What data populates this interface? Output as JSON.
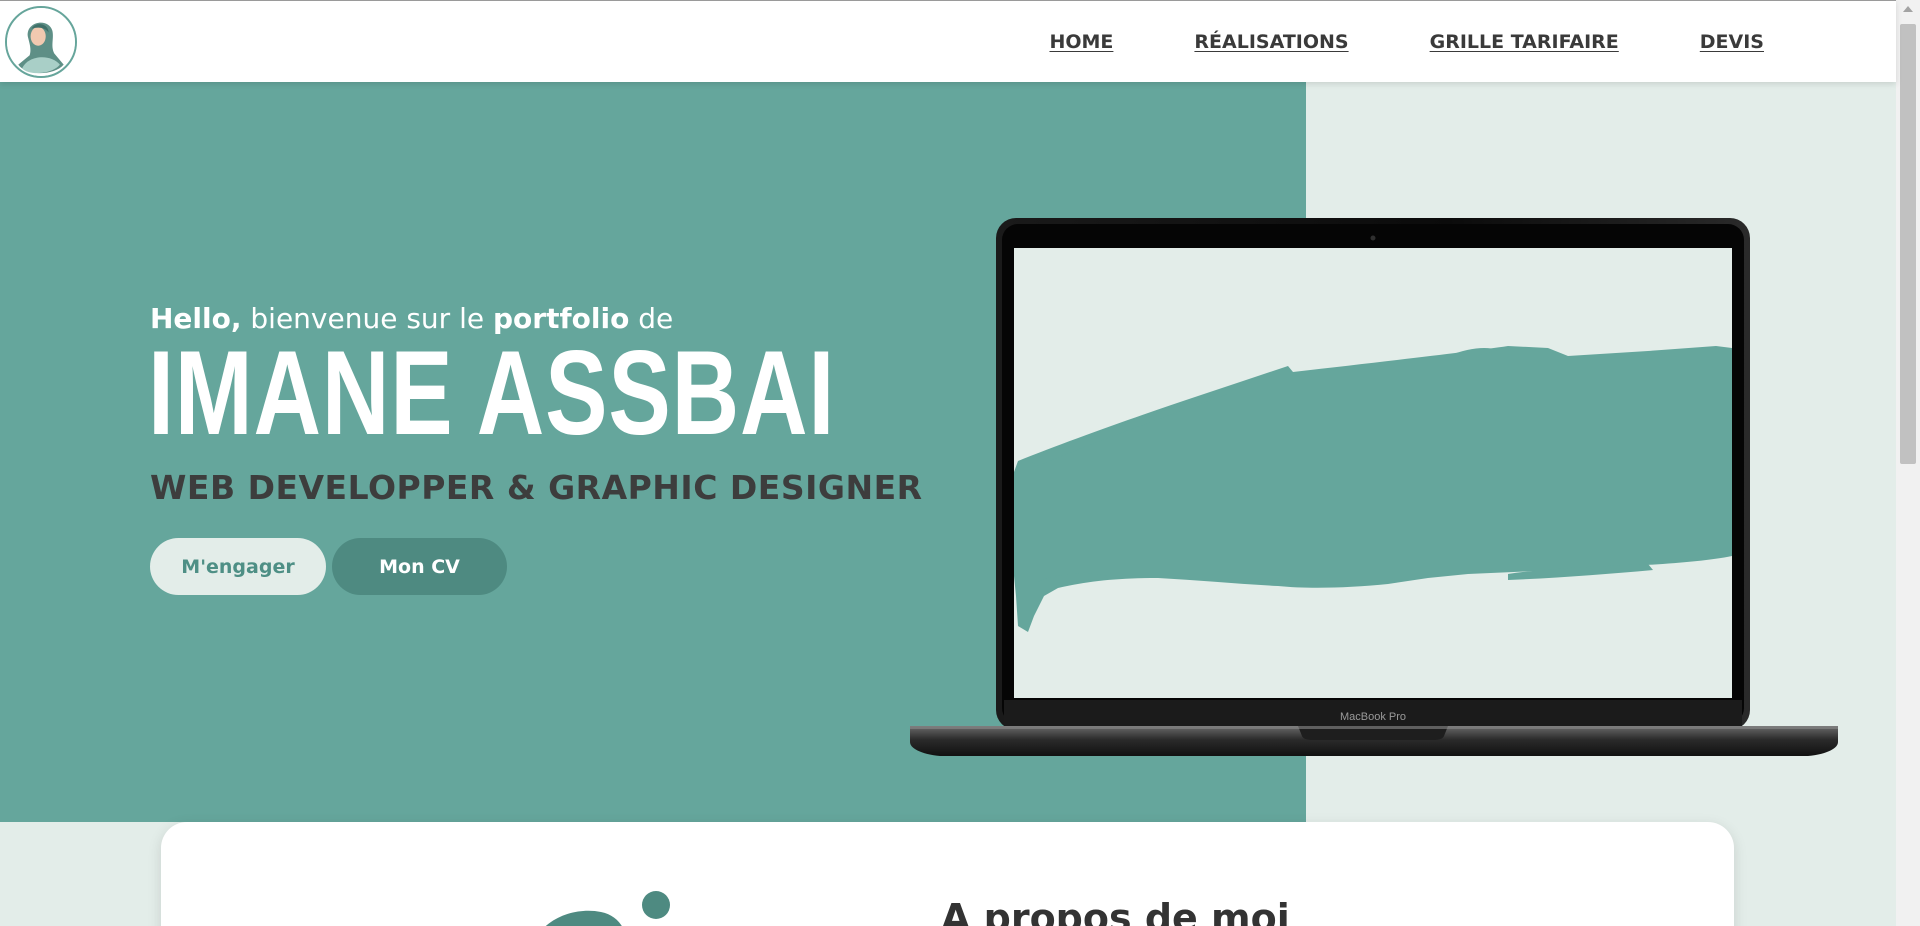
{
  "nav": {
    "logo_alt": "avatar",
    "links": [
      "HOME",
      "RÉALISATIONS",
      "GRILLE TARIFAIRE",
      "DEVIS"
    ]
  },
  "hero": {
    "greeting": {
      "hello": "Hello,",
      "part1": " bienvenue sur le ",
      "portfolio": "portfolio",
      "part2": " de"
    },
    "name": "IMANE ASSBAI",
    "subtitle": "WEB DEVELOPPER & GRAPHIC DESIGNER",
    "buttons": {
      "hire": "M'engager",
      "cv": "Mon CV"
    },
    "laptop_label": "MacBook Pro"
  },
  "about": {
    "title": "A propos de moi"
  },
  "colors": {
    "primary": "#65a69c",
    "light": "#e3ede9",
    "dark_button": "#4e8a81",
    "text_dark": "#3d3d3d"
  }
}
